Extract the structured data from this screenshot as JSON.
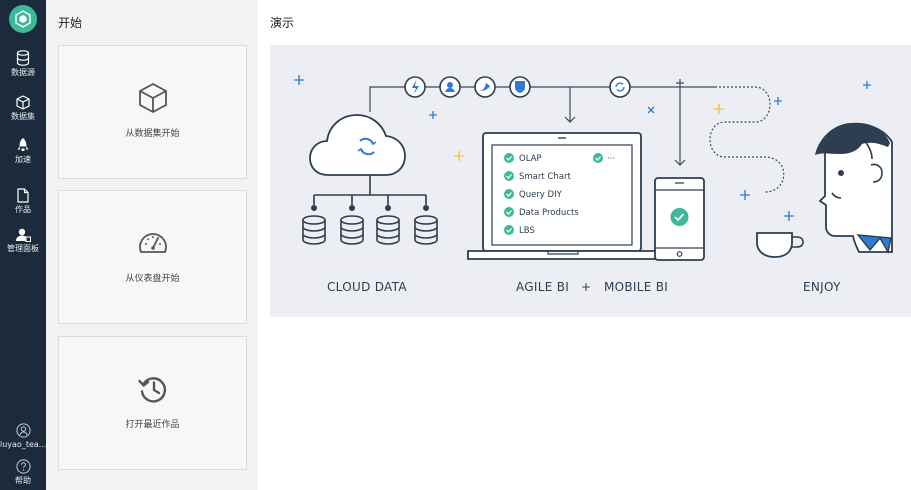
{
  "sidebar": {
    "items": [
      {
        "label": "数据源",
        "icon": "database-icon"
      },
      {
        "label": "数据集",
        "icon": "cube-icon"
      },
      {
        "label": "加速",
        "icon": "rocket-icon"
      },
      {
        "label": "作品",
        "icon": "document-icon"
      },
      {
        "label": "管理面板",
        "icon": "admin-user-icon"
      }
    ],
    "user": {
      "label": "luyao_tea...",
      "icon": "user-icon"
    },
    "help": {
      "label": "帮助",
      "icon": "help-icon"
    }
  },
  "start_panel": {
    "title": "开始",
    "cards": [
      {
        "label": "从数据集开始",
        "icon": "cube-icon"
      },
      {
        "label": "从仪表盘开始",
        "icon": "dashboard-gauge-icon"
      },
      {
        "label": "打开最近作品",
        "icon": "history-icon"
      }
    ]
  },
  "main": {
    "title": "演示",
    "illustration": {
      "captions": {
        "cloud": "CLOUD DATA",
        "agile": "AGILE BI",
        "plus": "+",
        "mobile": "MOBILE BI",
        "enjoy": "ENJOY"
      },
      "features": [
        "OLAP",
        "Smart Chart",
        "Query DIY",
        "Data Products",
        "LBS"
      ],
      "more": "···"
    }
  },
  "colors": {
    "rail": "#1b2b3c",
    "brand": "#3cb89a",
    "accent_blue": "#2d7bd3",
    "panel_bg": "#f2f2f2",
    "demo_bg": "#eceef3"
  }
}
